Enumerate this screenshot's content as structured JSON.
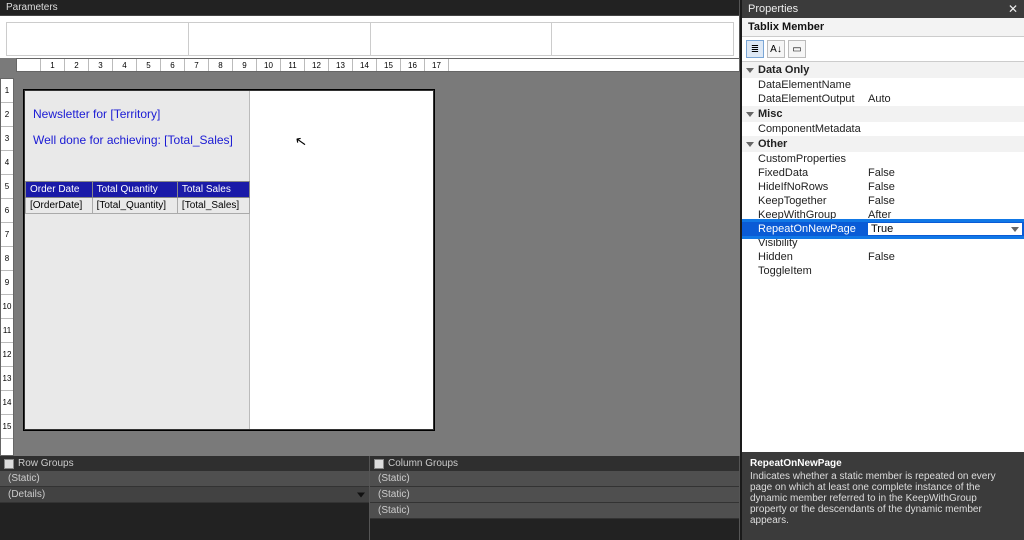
{
  "panels": {
    "parameters_title": "Parameters",
    "properties_title": "Properties",
    "row_groups_title": "Row Groups",
    "column_groups_title": "Column Groups"
  },
  "ruler": {
    "marks": [
      "",
      "1",
      "2",
      "3",
      "4",
      "5",
      "6",
      "7",
      "8",
      "9",
      "10",
      "11",
      "12",
      "13",
      "14",
      "15",
      "16",
      "17"
    ],
    "vmarks": [
      "1",
      "2",
      "3",
      "4",
      "5",
      "6",
      "7",
      "8",
      "9",
      "10",
      "11",
      "12",
      "13",
      "14",
      "15"
    ]
  },
  "report": {
    "line1": "Newsletter for [Territory]",
    "line2": "Well done for achieving: [Total_Sales]",
    "headers": [
      "Order Date",
      "Total Quantity",
      "Total Sales"
    ],
    "fields": [
      "[OrderDate]",
      "[Total_Quantity]",
      "[Total_Sales]"
    ]
  },
  "row_groups": [
    "(Static)",
    "(Details)"
  ],
  "col_groups": [
    "(Static)",
    "(Static)",
    "(Static)"
  ],
  "properties": {
    "object": "Tablix Member",
    "categories": [
      {
        "name": "Data Only",
        "items": [
          {
            "k": "DataElementName",
            "v": ""
          },
          {
            "k": "DataElementOutput",
            "v": "Auto"
          }
        ]
      },
      {
        "name": "Misc",
        "items": [
          {
            "k": "ComponentMetadata",
            "v": ""
          }
        ]
      },
      {
        "name": "Other",
        "items": [
          {
            "k": "CustomProperties",
            "v": ""
          },
          {
            "k": "FixedData",
            "v": "False"
          },
          {
            "k": "HideIfNoRows",
            "v": "False"
          },
          {
            "k": "KeepTogether",
            "v": "False"
          },
          {
            "k": "KeepWithGroup",
            "v": "After"
          },
          {
            "k": "RepeatOnNewPage",
            "v": "True",
            "selected": true
          },
          {
            "k": "Visibility",
            "v": ""
          },
          {
            "k": "Hidden",
            "v": "False"
          },
          {
            "k": "ToggleItem",
            "v": ""
          }
        ]
      }
    ],
    "help_title": "RepeatOnNewPage",
    "help_body": "Indicates whether a static member is repeated on every page on which at least one complete instance of the dynamic member referred to in the KeepWithGroup  property or the descendants of the dynamic member appears."
  },
  "icons": {
    "close": "✕",
    "sort": "A↓",
    "cat": "≣",
    "page": "▭",
    "cursor": "↖"
  }
}
